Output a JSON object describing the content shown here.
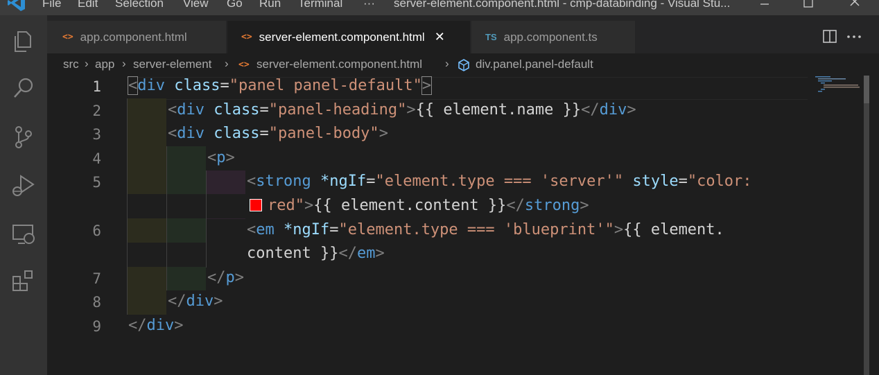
{
  "titlebar": {
    "menu": [
      "File",
      "Edit",
      "Selection",
      "View",
      "Go",
      "Run",
      "Terminal",
      "···"
    ],
    "title": "server-element.component.html - cmp-databinding - Visual Stu..."
  },
  "tabs": [
    {
      "label": "app.component.html",
      "icon": "<>",
      "active": false
    },
    {
      "label": "server-element.component.html",
      "icon": "<>",
      "active": true,
      "close": "✕"
    },
    {
      "label": "app.component.ts",
      "icon": "TS",
      "active": false
    }
  ],
  "breadcrumb": [
    "src",
    "app",
    "server-element",
    "server-element.component.html",
    "div.panel.panel-default"
  ],
  "editor": {
    "line_numbers": [
      "1",
      "2",
      "3",
      "4",
      "5",
      "",
      "6",
      "",
      "7",
      "8",
      "9"
    ],
    "active_line": "1"
  },
  "colors": {
    "tag": "#569cd6",
    "attribute": "#9cdcfe",
    "string": "#ce9178",
    "punctuation": "#808080",
    "text": "#d4d4d4",
    "color_swatch": "#ff0000"
  },
  "icons": {
    "activity": [
      "explorer-icon",
      "search-icon",
      "source-control-icon",
      "run-debug-icon",
      "remote-explorer-icon",
      "extensions-icon"
    ],
    "tab_actions": [
      "split-editor-icon",
      "more-actions-icon"
    ]
  }
}
